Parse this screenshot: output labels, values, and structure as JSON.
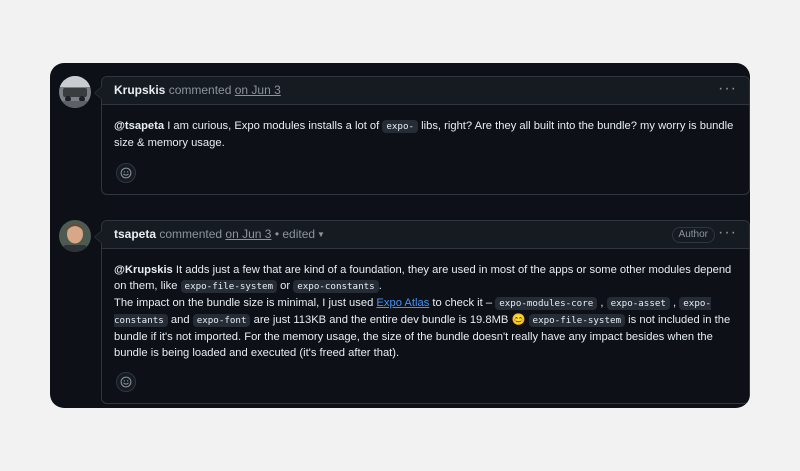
{
  "comments": [
    {
      "author": "Krupskis",
      "action": "commented",
      "date": "on Jun 3",
      "body": {
        "mention": "@tsapeta",
        "t1": "I am curious, Expo modules installs a lot of",
        "code1": "expo-",
        "t2": "libs, right? Are they all built into the bundle? my worry is bundle size & memory usage."
      }
    },
    {
      "author": "tsapeta",
      "action": "commented",
      "date": "on Jun 3",
      "edited": "• edited",
      "badge": "Author",
      "body": {
        "mention": "@Krupskis",
        "t1": "It adds just a few that are kind of a foundation, they are used in most of the apps or some other modules depend on them, like",
        "code1": "expo-file-system",
        "t2": "or",
        "code2": "expo-constants",
        "t3": ".",
        "t4": "The impact on the bundle size is minimal, I just used",
        "link": "Expo Atlas",
        "t5": "to check it –",
        "code3": "expo-modules-core",
        "t6": ",",
        "code4": "expo-asset",
        "t7": ",",
        "code5": "expo-constants",
        "t8": "and",
        "code6": "expo-font",
        "t9": "are just 113KB and the entire dev bundle is 19.8MB",
        "emoji": "😊",
        "code7": "expo-file-system",
        "t10": "is not included in the bundle if it's not imported. For the memory usage, the size of the bundle doesn't really have any impact besides when the bundle is being loaded and executed (it's freed after that)."
      }
    }
  ],
  "colors": {
    "background": "#0d1117",
    "header": "#161b22",
    "border": "#30363d",
    "link": "#4493f8"
  },
  "icons": [
    "kebab-menu-icon",
    "smiley-icon",
    "caret-down-icon"
  ]
}
